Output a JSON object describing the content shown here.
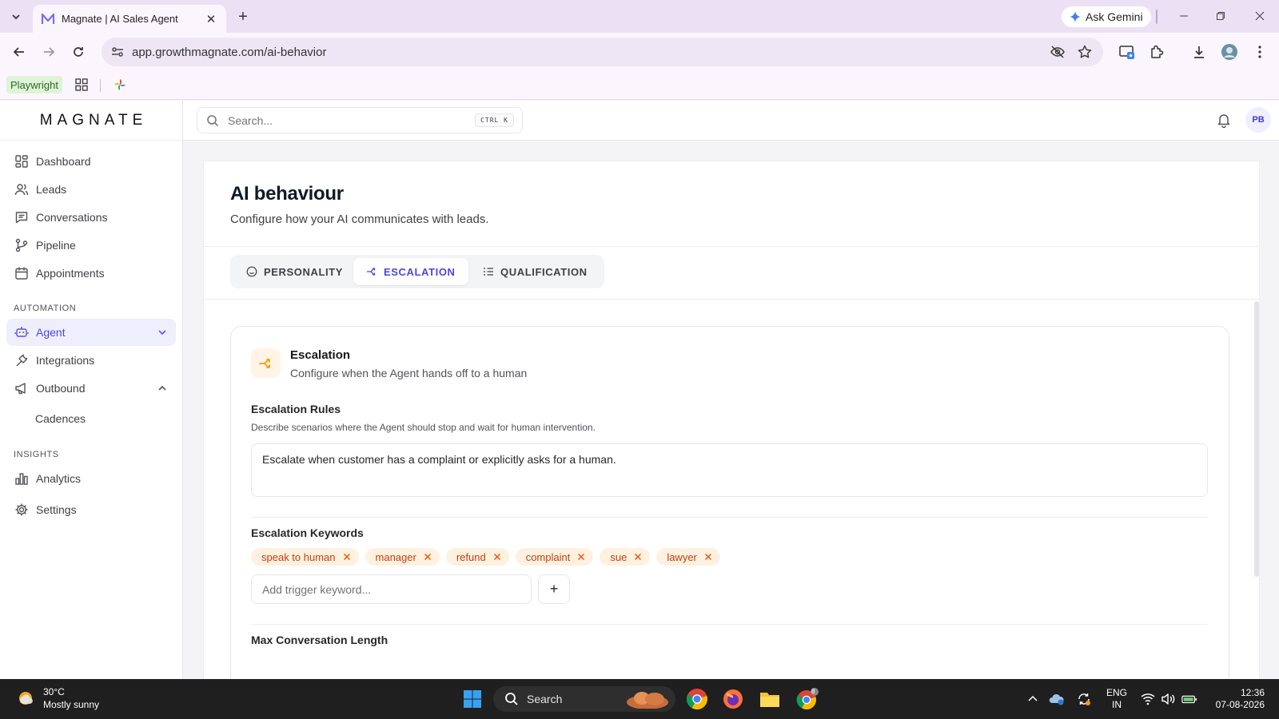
{
  "browser": {
    "tab_title": "Magnate | AI Sales Agent",
    "ask_gemini": "Ask Gemini",
    "url": "app.growthmagnate.com/ai-behavior",
    "bookmark_playwright": "Playwright"
  },
  "app": {
    "logo": "MAGNATE",
    "search_placeholder": "Search...",
    "search_shortcut": "CTRL K",
    "avatar_initials": "PB"
  },
  "sidebar": {
    "items": [
      {
        "label": "Dashboard",
        "icon": "dashboard-icon"
      },
      {
        "label": "Leads",
        "icon": "users-icon"
      },
      {
        "label": "Conversations",
        "icon": "message-icon"
      },
      {
        "label": "Pipeline",
        "icon": "git-branch-icon"
      },
      {
        "label": "Appointments",
        "icon": "calendar-icon"
      }
    ],
    "section_automation": "AUTOMATION",
    "agent": "Agent",
    "integrations": "Integrations",
    "outbound": "Outbound",
    "cadences": "Cadences",
    "section_insights": "INSIGHTS",
    "analytics": "Analytics",
    "settings": "Settings"
  },
  "page": {
    "title": "AI behaviour",
    "subtitle": "Configure how your AI communicates with leads.",
    "tabs": [
      {
        "label": "PERSONALITY",
        "active": false
      },
      {
        "label": "ESCALATION",
        "active": true
      },
      {
        "label": "QUALIFICATION",
        "active": false
      }
    ]
  },
  "escalation": {
    "title": "Escalation",
    "subtitle": "Configure when the Agent hands off to a human",
    "rules_label": "Escalation Rules",
    "rules_help": "Describe scenarios where the Agent should stop and wait for human intervention.",
    "rules_value": "Escalate when customer has a complaint or explicitly asks for a human.",
    "keywords_label": "Escalation Keywords",
    "keywords": [
      "speak to human",
      "manager",
      "refund",
      "complaint",
      "sue",
      "lawyer"
    ],
    "keyword_placeholder": "Add trigger keyword...",
    "add_label": "+",
    "max_length_label": "Max Conversation Length"
  },
  "colors": {
    "accent": "#4f46e5",
    "chip_bg": "#fff1e0",
    "chip_text": "#c2410c",
    "escalation_icon": "#f59e0b"
  },
  "taskbar": {
    "temperature": "30°C",
    "weather": "Mostly sunny",
    "search": "Search",
    "lang_top": "ENG",
    "lang_bottom": "IN",
    "time": "12:36",
    "date": "07-08-2026",
    "chrome_badge": "8"
  }
}
